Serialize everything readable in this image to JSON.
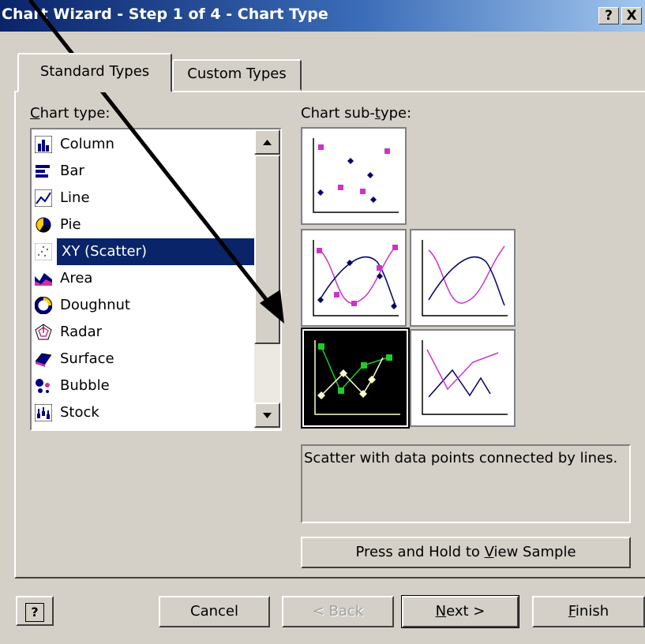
{
  "window": {
    "title": "Chart Wizard - Step 1 of 4 - Chart Type",
    "help_btn": "?",
    "close_btn": "X"
  },
  "tabs": [
    {
      "label": "Standard Types"
    },
    {
      "label": "Custom Types"
    }
  ],
  "chart_type": {
    "label_mnemonic": "C",
    "label_rest": "hart type:",
    "items": [
      {
        "label": "Column",
        "icon": "column-chart-icon"
      },
      {
        "label": "Bar",
        "icon": "bar-chart-icon"
      },
      {
        "label": "Line",
        "icon": "line-chart-icon"
      },
      {
        "label": "Pie",
        "icon": "pie-chart-icon"
      },
      {
        "label": "XY (Scatter)",
        "icon": "scatter-chart-icon"
      },
      {
        "label": "Area",
        "icon": "area-chart-icon"
      },
      {
        "label": "Doughnut",
        "icon": "doughnut-chart-icon"
      },
      {
        "label": "Radar",
        "icon": "radar-chart-icon"
      },
      {
        "label": "Surface",
        "icon": "surface-chart-icon"
      },
      {
        "label": "Bubble",
        "icon": "bubble-chart-icon"
      },
      {
        "label": "Stock",
        "icon": "stock-chart-icon"
      }
    ],
    "selected": "XY (Scatter)"
  },
  "subtype": {
    "label_a": "Chart sub-",
    "label_mnemonic": "t",
    "label_b": "ype:",
    "description": "Scatter with data points connected by lines."
  },
  "buttons": {
    "sample_a": "Press and Hold to ",
    "sample_mnemonic": "V",
    "sample_b": "iew Sample",
    "help": "?",
    "cancel": "Cancel",
    "back": "< Back",
    "next_mnemonic": "N",
    "next_b": "ext >",
    "finish_mnemonic": "F",
    "finish_b": "inish"
  },
  "colors": {
    "accent": "#0a246a",
    "dialog": "#d4d0c8",
    "magenta": "#cc33cc",
    "navy": "#000066",
    "green": "#22cc22",
    "cream": "#ffffcc"
  }
}
